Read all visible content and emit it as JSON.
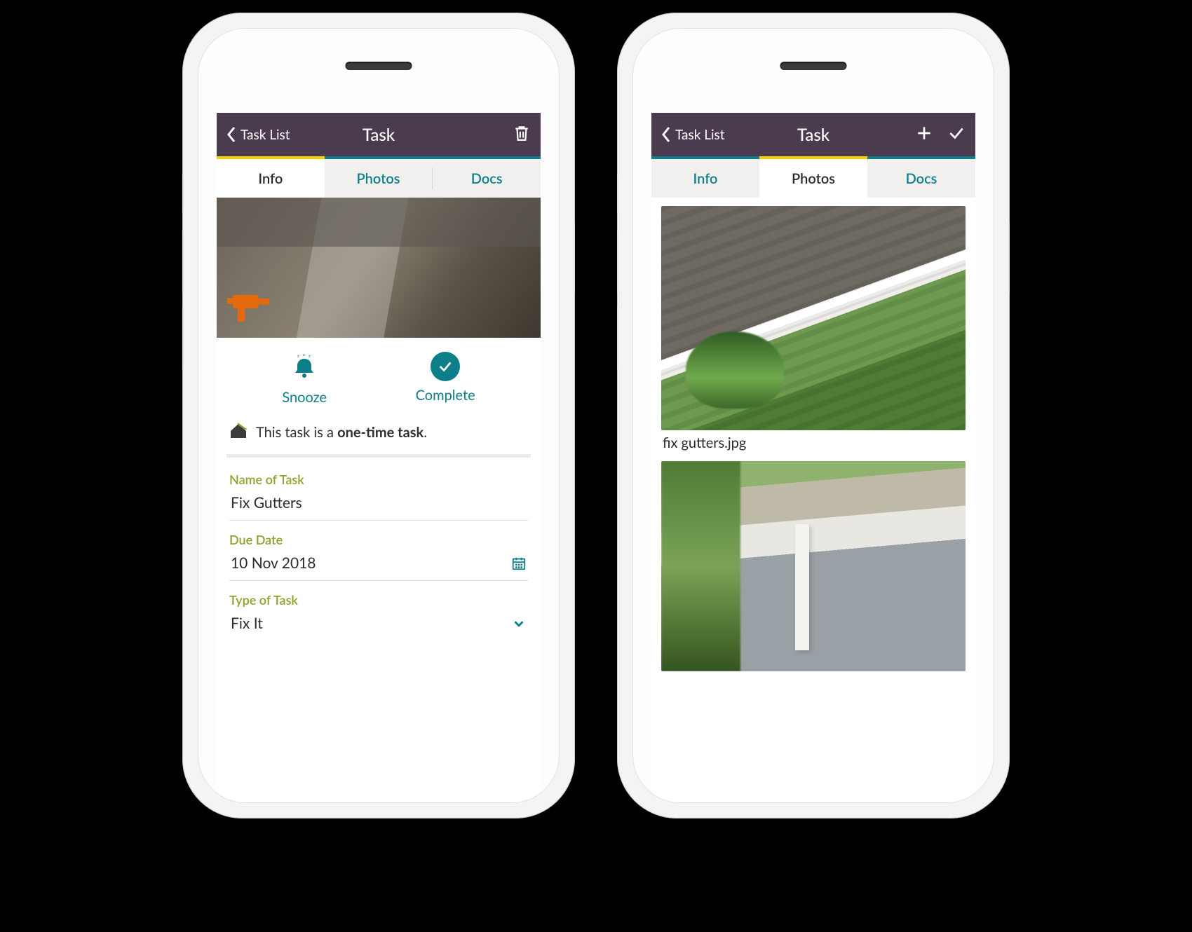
{
  "phone1": {
    "header": {
      "back_label": "Task List",
      "title": "Task"
    },
    "tabs": {
      "info": "Info",
      "photos": "Photos",
      "docs": "Docs",
      "active": "info"
    },
    "actions": {
      "snooze": "Snooze",
      "complete": "Complete"
    },
    "note_prefix": "This task is a ",
    "note_bold": "one-time task",
    "note_suffix": ".",
    "fields": {
      "name_label": "Name of Task",
      "name_value": "Fix Gutters",
      "due_label": "Due Date",
      "due_value": "10 Nov 2018",
      "type_label": "Type of Task",
      "type_value": "Fix It"
    }
  },
  "phone2": {
    "header": {
      "back_label": "Task List",
      "title": "Task"
    },
    "tabs": {
      "info": "Info",
      "photos": "Photos",
      "docs": "Docs",
      "active": "photos"
    },
    "photos": [
      {
        "caption": "fix gutters.jpg"
      }
    ]
  }
}
